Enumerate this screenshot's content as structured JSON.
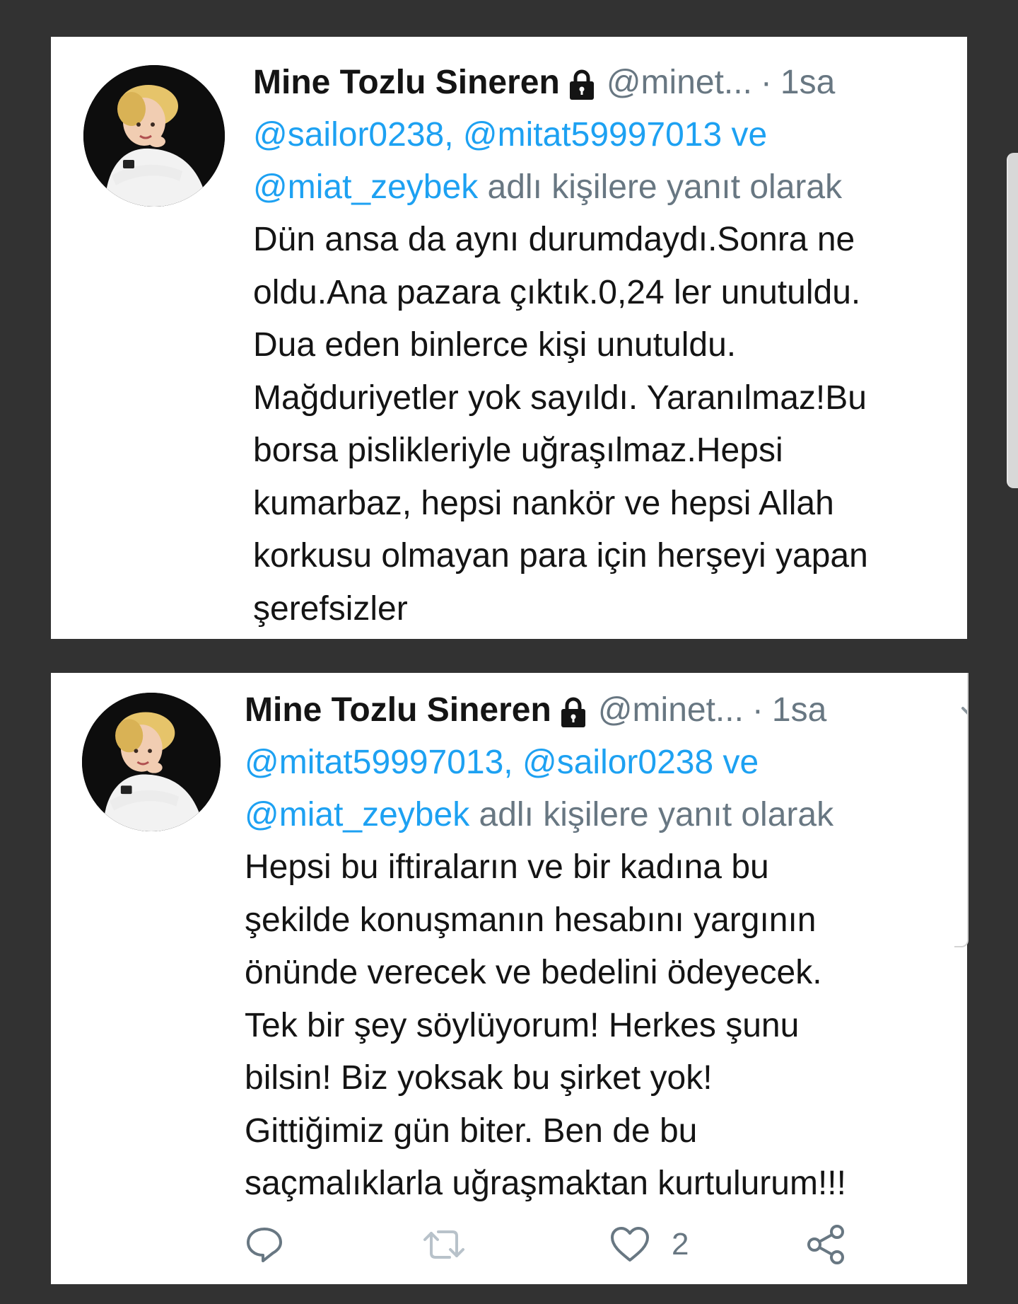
{
  "colors": {
    "background": "#323232",
    "card": "#ffffff",
    "text": "#141414",
    "secondary": "#687782",
    "link": "#1da1f2"
  },
  "tweets": [
    {
      "author": {
        "name": "Mine Tozlu Sineren",
        "handle": "@minet...",
        "protected_icon": "lock-icon",
        "avatar": "profile-photo"
      },
      "separator": "·",
      "time": "1sa",
      "menu_icon": "chevron-down-icon",
      "reply_to": {
        "line1": {
          "mention_a": "@sailor0238,",
          "mention_b": "@mitat59997013",
          "conj": "ve"
        },
        "line2": {
          "mention": "@miat_zeybek",
          "suffix": "adlı kişilere yanıt olarak"
        }
      },
      "text_lines": [
        "Dün ansa da aynı durumdaydı.Sonra ne",
        "oldu.Ana pazara çıktık.0,24 ler unutuldu.",
        "Dua eden binlerce kişi unutuldu.",
        "Mağduriyetler yok sayıldı. Yaranılmaz!Bu",
        "borsa pislikleriyle uğraşılmaz.Hepsi",
        "kumarbaz, hepsi nankör ve hepsi Allah",
        "korkusu olmayan para için herşeyi yapan",
        "şerefsizler"
      ]
    },
    {
      "author": {
        "name": "Mine Tozlu Sineren",
        "handle": "@minet...",
        "protected_icon": "lock-icon",
        "avatar": "profile-photo"
      },
      "separator": "·",
      "time": "1sa",
      "menu_icon": "chevron-down-icon",
      "reply_to": {
        "line1": {
          "mention_a": "@mitat59997013,",
          "mention_b": "@sailor0238",
          "conj": "ve"
        },
        "line2": {
          "mention": "@miat_zeybek",
          "suffix": "adlı kişilere yanıt olarak"
        }
      },
      "text_lines": [
        "Hepsi bu iftiraların ve bir kadına bu",
        "şekilde konuşmanın hesabını yargının",
        "önünde verecek ve bedelini ödeyecek.",
        "Tek bir şey söylüyorum! Herkes şunu",
        "bilsin! Biz yoksak bu şirket yok!",
        "Gittiğimiz gün biter. Ben de bu",
        "saçmalıklarla uğraşmaktan kurtulurum!!!"
      ],
      "actions": {
        "reply_icon": "reply-icon",
        "retweet_icon": "retweet-icon",
        "like_icon": "heart-icon",
        "like_count": "2",
        "share_icon": "share-icon"
      }
    }
  ]
}
